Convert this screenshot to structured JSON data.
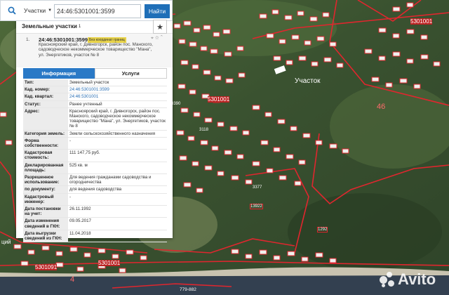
{
  "search": {
    "category": "Участки",
    "query": "24:46:5301001:3599",
    "find_label": "Найти"
  },
  "panel": {
    "title": "Земельные участки",
    "count": "1",
    "result": {
      "index": "1.",
      "cadnum": "24:46:5301001:3599",
      "badge": "Без координат границ",
      "address": "Красноярский край, г. Дивногорск, район пос. Манского, садоводческое некоммерческое товарищество \"Мана\", ул. Энергетиков, участок № 8"
    },
    "tabs": {
      "info": "Информация",
      "services": "Услуги"
    },
    "rows": [
      {
        "k": "Тип:",
        "v": "Земельный участок"
      },
      {
        "k": "Кад. номер:",
        "v": "24:46:5301001:3599",
        "link": true
      },
      {
        "k": "Кад. квартал:",
        "v": "24:46:5301001",
        "link": true
      },
      {
        "k": "Статус:",
        "v": "Ранее учтенный"
      },
      {
        "k": "Адрес:",
        "v": "Красноярский край, г. Дивногорск, район пос. Манского, садоводческое некоммерческое товарищество \"Мана\", ул. Энергетиков, участок № 8"
      },
      {
        "k": "Категория земель:",
        "v": "Земли сельскохозяйственного назначения"
      },
      {
        "k": "Форма собственности:",
        "v": "-"
      },
      {
        "k": "Кадастровая стоимость:",
        "v": "111 147,75 руб."
      },
      {
        "k": "Декларированная площадь:",
        "v": "525 кв. м"
      },
      {
        "k": "Разрешенное использование:",
        "v": "Для ведения гражданами садоводства и огородничества"
      },
      {
        "k": "по документу:",
        "v": "для ведения садоводства"
      },
      {
        "k": "Кадастровый инженер:",
        "v": "-"
      },
      {
        "k": "Дата постановки на учет:",
        "v": "26.11.1992"
      },
      {
        "k": "Дата изменения сведений в ГКН:",
        "v": "09.05.2017"
      },
      {
        "k": "Дата выгрузки сведений из ГКН:",
        "v": "11.04.2018"
      }
    ]
  },
  "map": {
    "labels": {
      "uchastok": "Участок",
      "block_a": "5301001",
      "block_b": "5301001",
      "block_c": "5301001",
      "block_d": "5301091",
      "num_46": "46",
      "num_4": "4",
      "parcel_3390": "3390",
      "parcel_3118": "3118",
      "parcel_3377": "3377",
      "parcel_13922": "13922",
      "parcel_1292": "1292",
      "parcel_bottom": "779-882",
      "fragment_left": "ций"
    },
    "watermark": "Avito"
  },
  "colors": {
    "boundary": "#e0262e",
    "parcel_fill": "#ffffff",
    "accent": "#2a79c6",
    "avito": "#ffffff"
  }
}
